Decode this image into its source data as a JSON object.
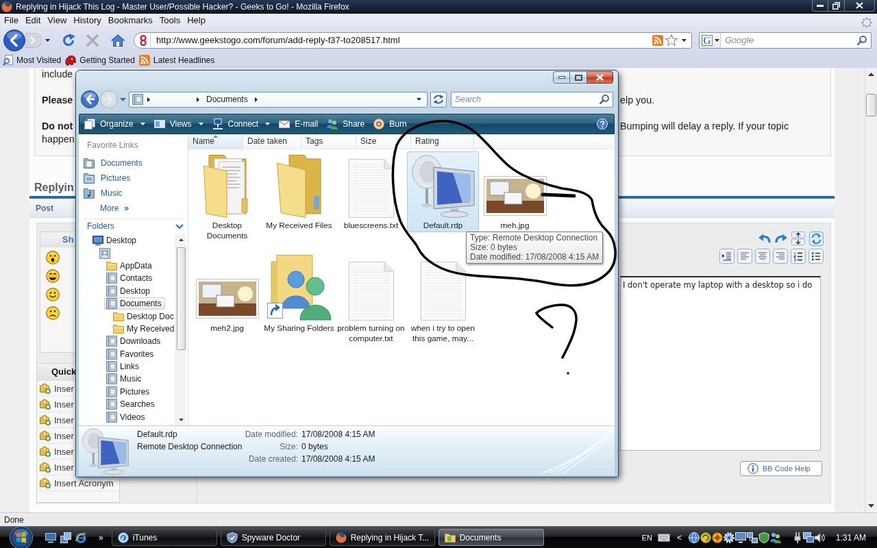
{
  "browser": {
    "title": "Replying in Hijack This Log - Master User/Possible Hacker? - Geeks to Go! - Mozilla Firefox",
    "menu": [
      "File",
      "Edit",
      "View",
      "History",
      "Bookmarks",
      "Tools",
      "Help"
    ],
    "navigation": [
      {
        "kind": "back",
        "disabled": false
      },
      {
        "kind": "forward",
        "disabled": true
      },
      {
        "kind": "reload",
        "disabled": false
      },
      {
        "kind": "stop",
        "disabled": true
      },
      {
        "kind": "home",
        "disabled": false
      }
    ],
    "url": "http://www.geekstogo.com/forum/add-reply-f37-to208517.html",
    "search": {
      "engine": "G",
      "placeholder": "Google"
    },
    "bookmarks": [
      {
        "label": "Most Visited",
        "kind": "smart"
      },
      {
        "label": "Getting Started",
        "kind": "site"
      },
      {
        "label": "Latest Headlines",
        "kind": "feed"
      }
    ],
    "status": "Done"
  },
  "forum": {
    "notice": [
      {
        "lines": [
          {
            "start": "include",
            "start_bold": false
          }
        ]
      },
      {
        "lines": [
          {
            "start": "Please",
            "start_bold": true,
            "end": "elp you."
          }
        ]
      },
      {
        "lines": [
          {
            "start": "Do not",
            "start_bold": true,
            "end": "Bumping will delay a reply. If your topic"
          },
          {
            "start": "happen",
            "start_bold": false
          }
        ]
      }
    ],
    "heading": "Replyin",
    "tab": "Post",
    "smilies": {
      "header": "Sh",
      "faces": [
        {
          "kind": "surprised"
        },
        {
          "kind": "laughing"
        },
        {
          "kind": "smiling"
        },
        {
          "kind": "sad"
        }
      ]
    },
    "quick": {
      "header": "Quick",
      "items": [
        "Inser",
        "Inser",
        "Inser",
        "Inser",
        "Inser",
        "Inser",
        "Insert Acronym"
      ]
    },
    "editor": {
      "tools_top": [
        {
          "kind": "undo"
        },
        {
          "kind": "redo"
        },
        {
          "kind": "resize"
        },
        {
          "kind": "refresh"
        }
      ],
      "tools_bottom": [
        {
          "kind": "indent"
        },
        {
          "kind": "align-left"
        },
        {
          "kind": "align-center"
        },
        {
          "kind": "align-right"
        },
        {
          "kind": "numbered-list"
        },
        {
          "kind": "bullet-list"
        }
      ],
      "message": "I don't operate my laptop with a desktop so i do",
      "help_button": "BB Code Help"
    }
  },
  "explorer": {
    "navigation": [
      {
        "kind": "back",
        "disabled": false
      },
      {
        "kind": "forward",
        "disabled": true
      }
    ],
    "breadcrumb": [
      "Documents"
    ],
    "search": {
      "placeholder": "Search"
    },
    "commands": [
      {
        "label": "Organize",
        "kind": "organize",
        "menu": true
      },
      {
        "label": "Views",
        "kind": "views",
        "menu": true
      },
      {
        "label": "Connect",
        "kind": "connect",
        "menu": true
      },
      {
        "label": "E-mail",
        "kind": "email",
        "menu": false
      },
      {
        "label": "Share",
        "kind": "share",
        "menu": false
      },
      {
        "label": "Burn",
        "kind": "burn",
        "menu": false
      }
    ],
    "favorite_links": {
      "title": "Favorite Links",
      "items": [
        {
          "label": "Documents",
          "kind": "documents"
        },
        {
          "label": "Pictures",
          "kind": "pictures"
        },
        {
          "label": "Music",
          "kind": "music"
        }
      ],
      "more": "More",
      "more_chevron": "»"
    },
    "folders": {
      "title": "Folders",
      "tree": [
        {
          "label": "Desktop",
          "kind": "desktop",
          "selected": false,
          "children": [
            {
              "kind": "user",
              "selected": false,
              "children": [
                {
                  "label": "AppData",
                  "kind": "folder",
                  "selected": false
                },
                {
                  "label": "Contacts",
                  "kind": "system",
                  "selected": false
                },
                {
                  "label": "Desktop",
                  "kind": "system",
                  "selected": false
                },
                {
                  "label": "Documents",
                  "kind": "system",
                  "selected": true,
                  "children": [
                    {
                      "label": "Desktop Doc",
                      "kind": "folder",
                      "selected": false
                    },
                    {
                      "label": "My Received",
                      "kind": "folder",
                      "selected": false
                    }
                  ]
                },
                {
                  "label": "Downloads",
                  "kind": "system",
                  "selected": false
                },
                {
                  "label": "Favorites",
                  "kind": "system",
                  "selected": false
                },
                {
                  "label": "Links",
                  "kind": "system",
                  "selected": false
                },
                {
                  "label": "Music",
                  "kind": "system",
                  "selected": false
                },
                {
                  "label": "Pictures",
                  "kind": "system",
                  "selected": false
                },
                {
                  "label": "Searches",
                  "kind": "system",
                  "selected": false
                },
                {
                  "label": "Videos",
                  "kind": "system",
                  "selected": false
                }
              ]
            }
          ]
        }
      ]
    },
    "columns": [
      {
        "label": "Name",
        "sorted": true
      },
      {
        "label": "Date taken",
        "sorted": false
      },
      {
        "label": "Tags",
        "sorted": false
      },
      {
        "label": "Size",
        "sorted": false
      },
      {
        "label": "Rating",
        "sorted": false
      }
    ],
    "files": [
      {
        "name": "Desktop Documents",
        "kind": "folder-files",
        "selected": false
      },
      {
        "name": "My Received Files",
        "kind": "folder",
        "selected": false
      },
      {
        "name": "bluescreens.txt",
        "kind": "text",
        "selected": false
      },
      {
        "name": "Default.rdp",
        "kind": "remote-desktop",
        "selected": true
      },
      {
        "name": "meh.jpg",
        "kind": "image",
        "selected": false
      },
      {
        "name": "meh2.jpg",
        "kind": "image",
        "selected": false
      },
      {
        "name": "My Sharing Folders",
        "kind": "shared-folder",
        "selected": false
      },
      {
        "name": "problem turning on computer.txt",
        "kind": "text",
        "selected": false
      },
      {
        "name": "when i try to open this game, may...",
        "kind": "text",
        "selected": false
      }
    ],
    "tooltip": [
      "Type: Remote Desktop Connection",
      "Size: 0 bytes",
      "Date modified: 17/08/2008 4:15 AM"
    ],
    "details": {
      "name": "Default.rdp",
      "type": "Remote Desktop Connection",
      "kind": "remote-desktop",
      "properties": [
        {
          "label": "Date modified:",
          "value": "17/08/2008 4:15 AM"
        },
        {
          "label": "Size:",
          "value": "0 bytes"
        },
        {
          "label": "Date created:",
          "value": "17/08/2008 4:15 AM"
        }
      ]
    }
  },
  "taskbar": {
    "quick_launch": [
      {
        "kind": "desktop"
      },
      {
        "kind": "switcher"
      },
      {
        "kind": "browser"
      }
    ],
    "more": "»",
    "tasks": [
      {
        "label": "iTunes",
        "kind": "music",
        "selected": false
      },
      {
        "label": "Spyware Doctor",
        "kind": "shield",
        "selected": false
      },
      {
        "label": "Replying in Hijack T...",
        "kind": "firefox",
        "selected": false
      },
      {
        "label": "Documents",
        "kind": "folder",
        "selected": true
      }
    ],
    "language": "EN",
    "tray_toggle": "<",
    "clock": "1:31 AM"
  }
}
